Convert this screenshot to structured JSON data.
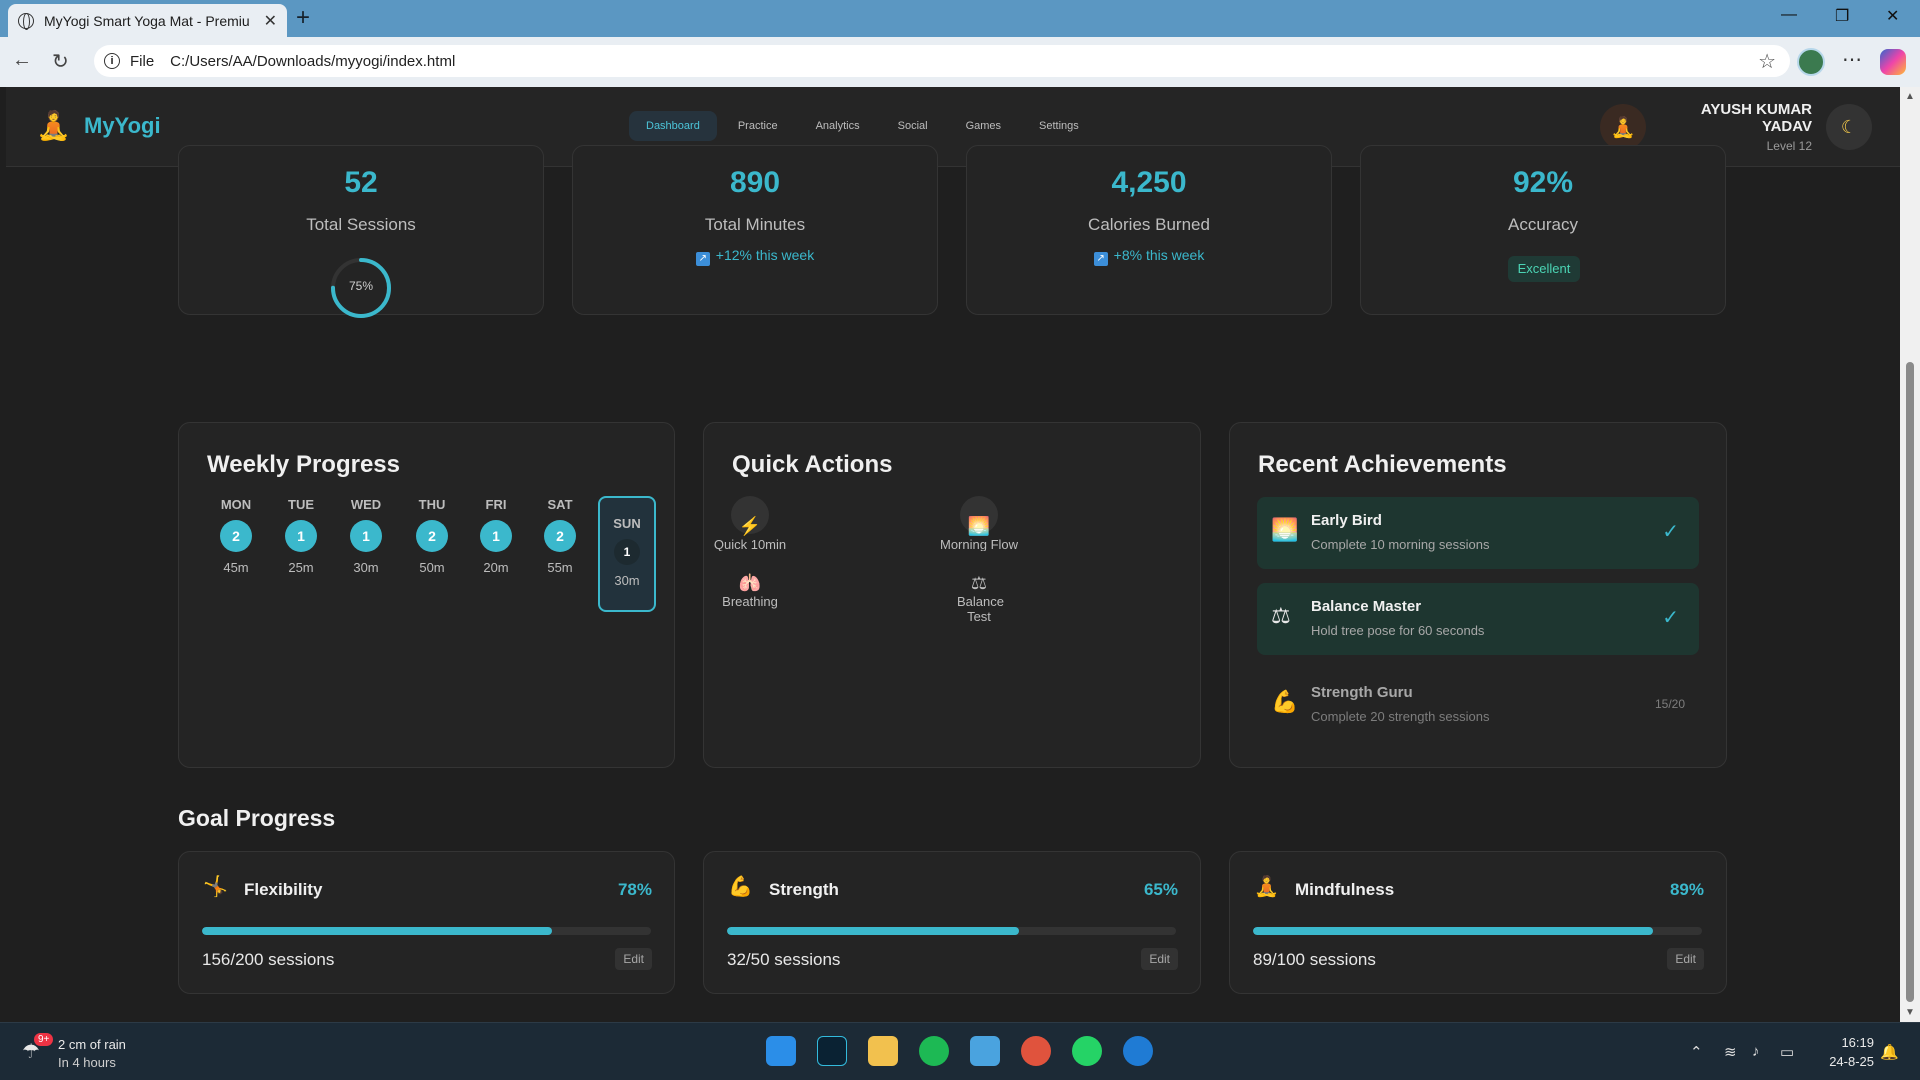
{
  "browser": {
    "tab_title": "MyYogi Smart Yoga Mat - Premiu",
    "file_label": "File",
    "url": "C:/Users/AA/Downloads/myyogi/index.html"
  },
  "app": {
    "logo_text": "MyYogi",
    "nav": [
      "Dashboard",
      "Practice",
      "Analytics",
      "Social",
      "Games",
      "Settings"
    ],
    "user_name": "AYUSH KUMAR YADAV",
    "user_level": "Level 12"
  },
  "stats": [
    {
      "value": "52",
      "label": "Total Sessions",
      "ring_text": "75%",
      "ring_fraction": 0.75
    },
    {
      "value": "890",
      "label": "Total Minutes",
      "sub": "+12% this week"
    },
    {
      "value": "4,250",
      "label": "Calories Burned",
      "sub": "+8% this week"
    },
    {
      "value": "92%",
      "label": "Accuracy",
      "badge": "Excellent"
    }
  ],
  "weekly": {
    "title": "Weekly Progress",
    "days": [
      {
        "day": "MON",
        "count": "2",
        "mins": "45m"
      },
      {
        "day": "TUE",
        "count": "1",
        "mins": "25m"
      },
      {
        "day": "WED",
        "count": "1",
        "mins": "30m"
      },
      {
        "day": "THU",
        "count": "2",
        "mins": "50m"
      },
      {
        "day": "FRI",
        "count": "1",
        "mins": "20m"
      },
      {
        "day": "SAT",
        "count": "2",
        "mins": "55m"
      },
      {
        "day": "SUN",
        "count": "1",
        "mins": "30m"
      }
    ]
  },
  "quick_actions": {
    "title": "Quick Actions",
    "items": [
      {
        "label": "Quick 10min",
        "icon": "lightning-icon"
      },
      {
        "label": "Morning Flow",
        "icon": "sunrise-icon"
      },
      {
        "label": "Breathing",
        "icon": "lungs-icon"
      },
      {
        "label": "Balance Test",
        "icon": "scales-icon"
      }
    ]
  },
  "achievements": {
    "title": "Recent Achievements",
    "items": [
      {
        "name": "Early Bird",
        "desc": "Complete 10 morning sessions",
        "status": "done"
      },
      {
        "name": "Balance Master",
        "desc": "Hold tree pose for 60 seconds",
        "status": "done"
      },
      {
        "name": "Strength Guru",
        "desc": "Complete 20 strength sessions",
        "progress": "15/20"
      }
    ]
  },
  "goals": {
    "title": "Goal Progress",
    "edit_label": "Edit",
    "items": [
      {
        "name": "Flexibility",
        "pct": "78%",
        "fraction": 0.78,
        "sessions": "156/200 sessions"
      },
      {
        "name": "Strength",
        "pct": "65%",
        "fraction": 0.65,
        "sessions": "32/50 sessions"
      },
      {
        "name": "Mindfulness",
        "pct": "89%",
        "fraction": 0.89,
        "sessions": "89/100 sessions"
      }
    ]
  },
  "taskbar": {
    "weather_badge": "9+",
    "weather_line1": "2 cm of rain",
    "weather_line2": "In 4 hours",
    "time": "16:19",
    "date": "24-8-25"
  },
  "colors": {
    "accent": "#3bb8cc",
    "background": "#1f1f1f",
    "card": "#242424"
  }
}
